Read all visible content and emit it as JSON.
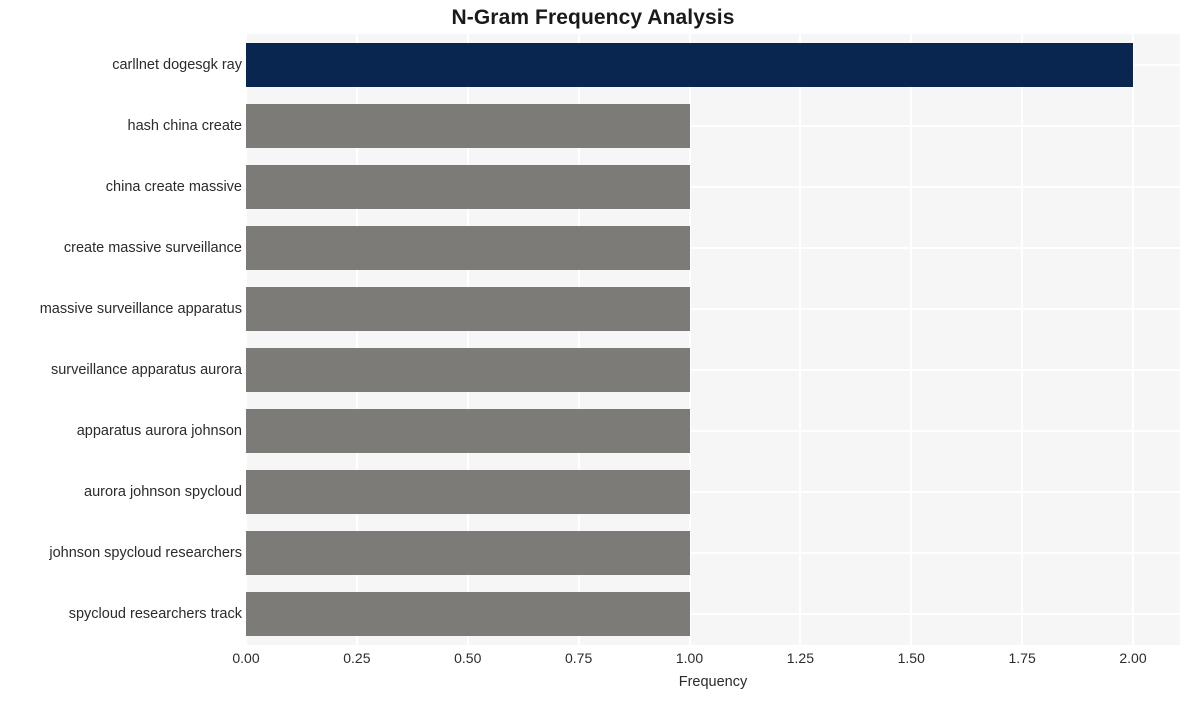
{
  "chart_data": {
    "type": "bar",
    "orientation": "horizontal",
    "title": "N-Gram Frequency Analysis",
    "xlabel": "Frequency",
    "ylabel": "",
    "categories": [
      "carllnet dogesgk ray",
      "hash china create",
      "china create massive",
      "create massive surveillance",
      "massive surveillance apparatus",
      "surveillance apparatus aurora",
      "apparatus aurora johnson",
      "aurora johnson spycloud",
      "johnson spycloud researchers",
      "spycloud researchers track"
    ],
    "values": [
      2,
      1,
      1,
      1,
      1,
      1,
      1,
      1,
      1,
      1
    ],
    "xlim": [
      0,
      2
    ],
    "xticks": [
      0,
      0.25,
      0.5,
      0.75,
      1,
      1.25,
      1.5,
      1.75,
      2
    ],
    "xtick_labels": [
      "0.00",
      "0.25",
      "0.50",
      "0.75",
      "1.00",
      "1.25",
      "1.50",
      "1.75",
      "2.00"
    ],
    "bar_colors": [
      "#08264f",
      "#7c7b78",
      "#7c7b78",
      "#7c7b78",
      "#7c7b78",
      "#7c7b78",
      "#7c7b78",
      "#7c7b78",
      "#7c7b78",
      "#7c7b78"
    ],
    "grid": true,
    "grid_color": "#ffffff",
    "plot_background": "#f6f6f6",
    "figure_background": "#ffffff",
    "legend": null
  }
}
